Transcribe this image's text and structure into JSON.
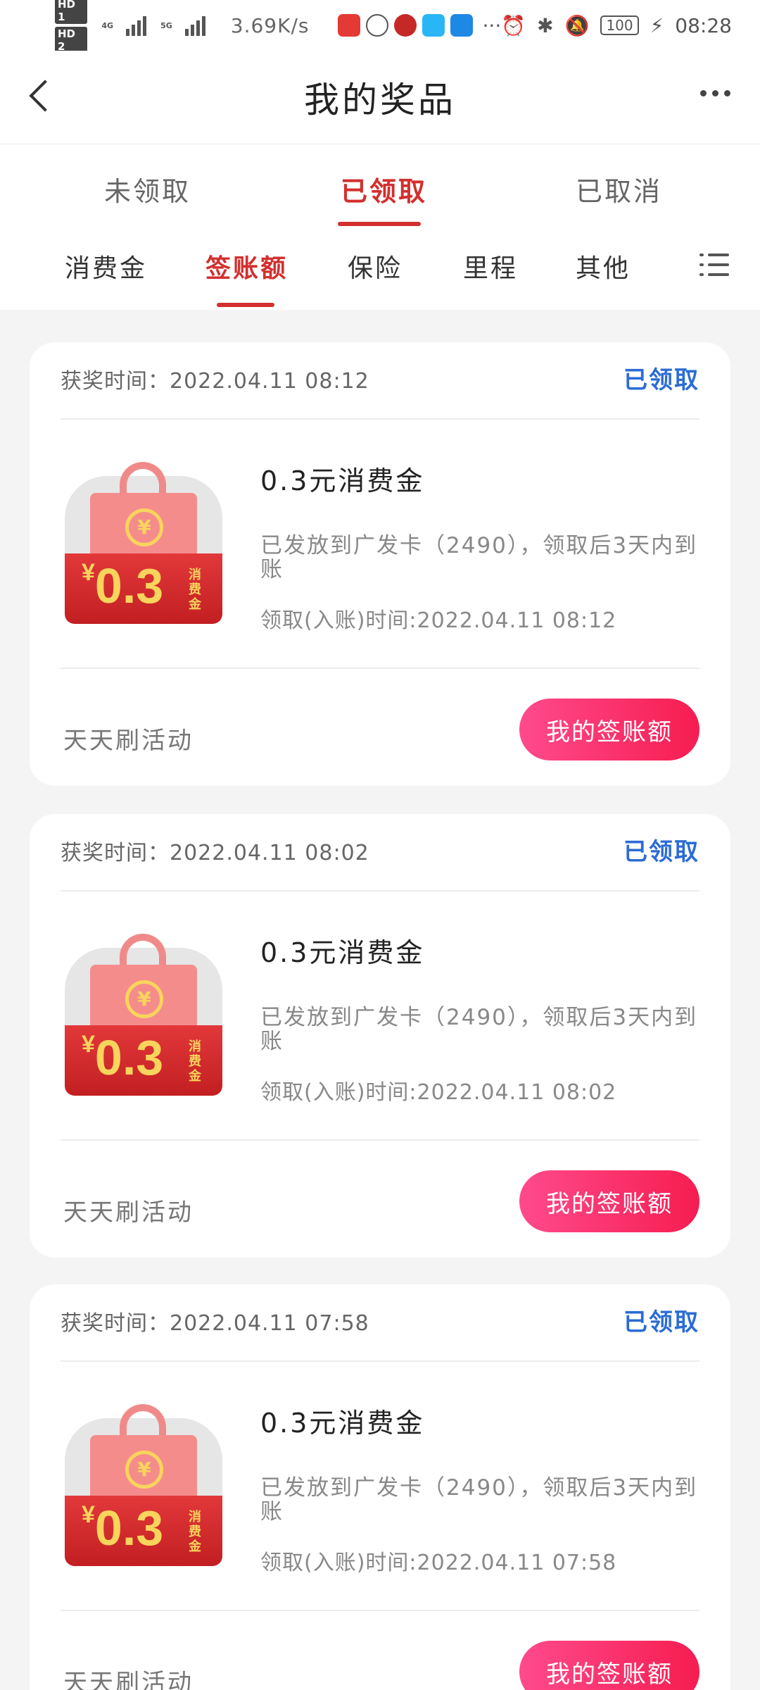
{
  "status_bar": {
    "hd1": "HD 1",
    "hd2": "HD 2",
    "net1": "4G",
    "net2": "5G",
    "speed": "3.69K/s",
    "battery": "100",
    "time": "08:28"
  },
  "header": {
    "title": "我的奖品"
  },
  "main_tabs": [
    {
      "label": "未领取"
    },
    {
      "label": "已领取"
    },
    {
      "label": "已取消"
    }
  ],
  "active_main_tab": 1,
  "sub_tabs": [
    {
      "label": "消费金"
    },
    {
      "label": "签账额"
    },
    {
      "label": "保险"
    },
    {
      "label": "里程"
    },
    {
      "label": "其他"
    }
  ],
  "active_sub_tab": 1,
  "cards": [
    {
      "award_time": "获奖时间：2022.04.11  08:12",
      "status": "已领取",
      "bag_yen": "¥",
      "bag_amount": "0.3",
      "bag_tag": "消费金",
      "title": "0.3元消费金",
      "desc": "已发放到广发卡（2490），领取后3天内到账",
      "claim_time": "领取(入账)时间:2022.04.11  08:12",
      "activity": "天天刷活动",
      "button": "我的签账额"
    },
    {
      "award_time": "获奖时间：2022.04.11  08:02",
      "status": "已领取",
      "bag_yen": "¥",
      "bag_amount": "0.3",
      "bag_tag": "消费金",
      "title": "0.3元消费金",
      "desc": "已发放到广发卡（2490），领取后3天内到账",
      "claim_time": "领取(入账)时间:2022.04.11  08:02",
      "activity": "天天刷活动",
      "button": "我的签账额"
    },
    {
      "award_time": "获奖时间：2022.04.11  07:58",
      "status": "已领取",
      "bag_yen": "¥",
      "bag_amount": "0.3",
      "bag_tag": "消费金",
      "title": "0.3元消费金",
      "desc": "已发放到广发卡（2490），领取后3天内到账",
      "claim_time": "领取(入账)时间:2022.04.11  07:58",
      "activity": "天天刷活动",
      "button": "我的签账额"
    }
  ],
  "colors": {
    "accent_red": "#d32f2f",
    "status_blue": "#2b6cd6",
    "button_gradient_start": "#ff4a8d",
    "button_gradient_end": "#f61d50"
  },
  "icons": [
    "back-arrow-icon",
    "more-dots-icon",
    "menu-list-icon",
    "shopping-bag-icon",
    "yen-coin-icon",
    "alarm-icon",
    "bluetooth-icon",
    "mute-icon",
    "charging-icon"
  ]
}
